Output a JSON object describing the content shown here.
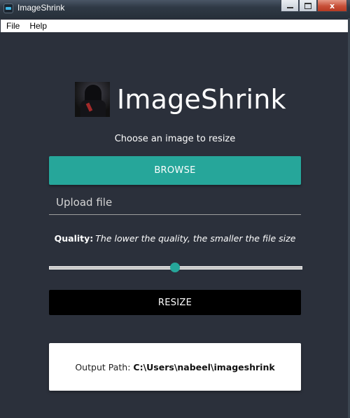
{
  "window": {
    "title": "ImageShrink",
    "minimize_label": "",
    "maximize_label": "",
    "close_label": "x"
  },
  "menu": {
    "items": [
      {
        "label": "File"
      },
      {
        "label": "Help"
      }
    ]
  },
  "header": {
    "app_name": "ImageShrink",
    "subtitle": "Choose an image to resize"
  },
  "form": {
    "browse_label": "BROWSE",
    "upload_placeholder": "Upload file",
    "upload_value": "",
    "quality_label": "Quality:",
    "quality_hint": "The lower the quality, the smaller the file size",
    "quality_value_fraction": 0.5,
    "resize_label": "RESIZE"
  },
  "output": {
    "label": "Output Path:",
    "path": "C:\\Users\\nabeel\\imageshrink"
  },
  "colors": {
    "background": "#2b303b",
    "accent": "#26a69a",
    "resize_button": "#000000",
    "card": "#ffffff"
  }
}
